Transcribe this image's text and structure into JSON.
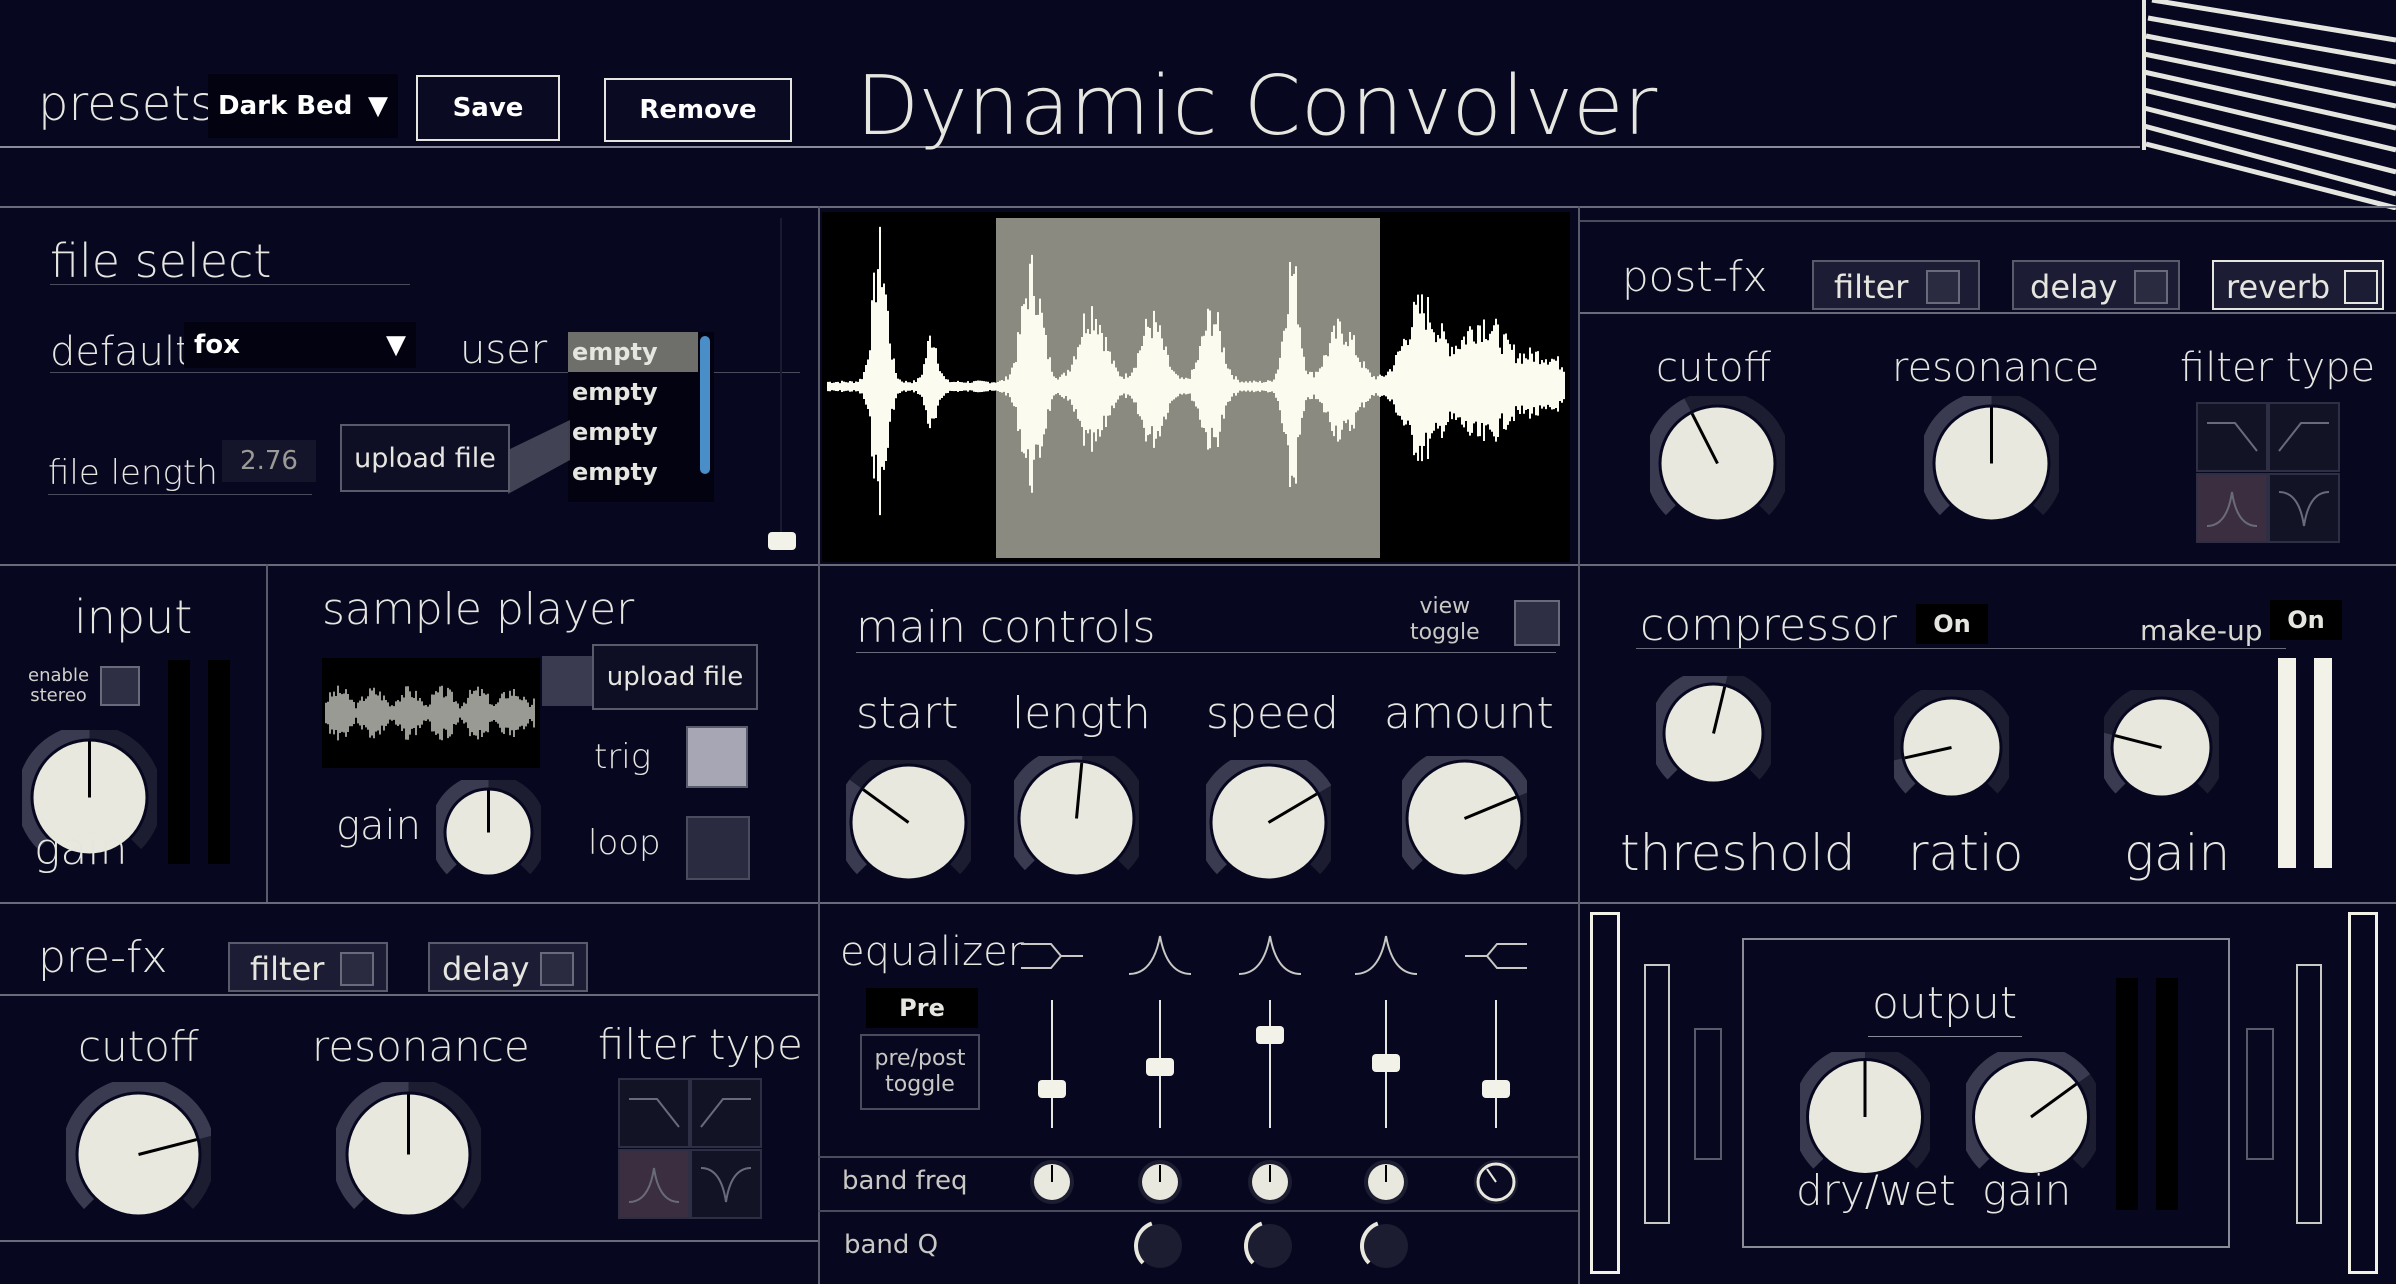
{
  "header": {
    "presets_label": "presets",
    "preset_value": "Dark Bed",
    "save_label": "Save",
    "remove_label": "Remove",
    "title": "Dynamic Convolver"
  },
  "file_select": {
    "title": "file select",
    "default_label": "default",
    "default_value": "fox",
    "user_label": "user",
    "user_items": [
      "empty",
      "empty",
      "empty",
      "empty"
    ],
    "file_length_label": "file length",
    "file_length_value": "2.76",
    "upload_label": "upload file"
  },
  "post_fx": {
    "title": "post-fx",
    "filter_label": "filter",
    "delay_label": "delay",
    "reverb_label": "reverb",
    "cutoff_label": "cutoff",
    "resonance_label": "resonance",
    "filter_type_label": "filter type"
  },
  "input": {
    "title": "input",
    "enable_stereo_label": "enable\nstereo",
    "gain_label": "gain"
  },
  "sample_player": {
    "title": "sample player",
    "upload_label": "upload file",
    "trig_label": "trig",
    "loop_label": "loop",
    "gain_label": "gain"
  },
  "main_controls": {
    "title": "main controls",
    "view_toggle_label": "view\ntoggle",
    "start_label": "start",
    "length_label": "length",
    "speed_label": "speed",
    "amount_label": "amount"
  },
  "compressor": {
    "title": "compressor",
    "on_label": "On",
    "makeup_label": "make-up",
    "makeup_on_label": "On",
    "threshold_label": "threshold",
    "ratio_label": "ratio",
    "gain_label": "gain"
  },
  "pre_fx": {
    "title": "pre-fx",
    "filter_label": "filter",
    "delay_label": "delay",
    "cutoff_label": "cutoff",
    "resonance_label": "resonance",
    "filter_type_label": "filter type"
  },
  "equalizer": {
    "title": "equalizer",
    "pre_label": "Pre",
    "toggle_label": "pre/post\ntoggle",
    "band_freq_label": "band freq",
    "band_q_label": "band Q",
    "band_icons": [
      "lowshelf-icon",
      "peak-icon",
      "peak-icon",
      "peak-icon",
      "highshelf-icon"
    ]
  },
  "output": {
    "title": "output",
    "drywet_label": "dry/wet",
    "gain_label": "gain"
  },
  "colors": {
    "background": "#070820",
    "knob_face": "#e8e8de",
    "knob_arc": "#3a3b50",
    "selection": "#8c8c82"
  }
}
